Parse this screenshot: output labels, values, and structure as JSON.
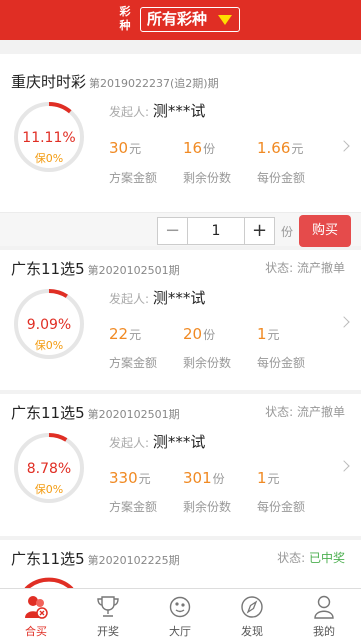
{
  "header": {
    "lottery_label": "彩种",
    "selector_label": "所有彩种"
  },
  "cards": [
    {
      "name": "重庆时时彩",
      "period": "第2019022237(追2期)期",
      "percent": "11.11%",
      "percent_value": 0.1111,
      "bao": "保0%",
      "initiator_label": "发起人:",
      "initiator_name": "测***试",
      "stats": [
        {
          "value": "30",
          "unit": "元",
          "label": "方案金额"
        },
        {
          "value": "16",
          "unit": "份",
          "label": "剩余份数"
        },
        {
          "value": "1.66",
          "unit": "元",
          "label": "每份金额"
        }
      ]
    },
    {
      "name": "广东11选5",
      "period": "第2020102501期",
      "status_label": "状态:",
      "status_value": "流产撤单",
      "percent": "9.09%",
      "percent_value": 0.0909,
      "bao": "保0%",
      "initiator_label": "发起人:",
      "initiator_name": "测***试",
      "stats": [
        {
          "value": "22",
          "unit": "元",
          "label": "方案金额"
        },
        {
          "value": "20",
          "unit": "份",
          "label": "剩余份数"
        },
        {
          "value": "1",
          "unit": "元",
          "label": "每份金额"
        }
      ]
    },
    {
      "name": "广东11选5",
      "period": "第2020102501期",
      "status_label": "状态:",
      "status_value": "流产撤单",
      "percent": "8.78%",
      "percent_value": 0.0878,
      "bao": "保0%",
      "initiator_label": "发起人:",
      "initiator_name": "测***试",
      "stats": [
        {
          "value": "330",
          "unit": "元",
          "label": "方案金额"
        },
        {
          "value": "301",
          "unit": "份",
          "label": "剩余份数"
        },
        {
          "value": "1",
          "unit": "元",
          "label": "每份金额"
        }
      ]
    },
    {
      "name": "广东11选5",
      "period": "第2020102225期",
      "status_label": "状态:",
      "status_value": "已中奖"
    }
  ],
  "buy": {
    "quantity": "1",
    "minus": "−",
    "plus": "+",
    "unit": "份",
    "button": "购买"
  },
  "tabs": [
    {
      "label": "合买",
      "icon": "group-buy-icon",
      "active": true
    },
    {
      "label": "开奖",
      "icon": "trophy-icon"
    },
    {
      "label": "大厅",
      "icon": "lobby-icon"
    },
    {
      "label": "发现",
      "icon": "compass-icon"
    },
    {
      "label": "我的",
      "icon": "user-icon"
    }
  ],
  "colors": {
    "brand": "#e02e24",
    "amount": "#f08a24",
    "won": "#4caf50",
    "buy_button": "#e54b4b"
  }
}
